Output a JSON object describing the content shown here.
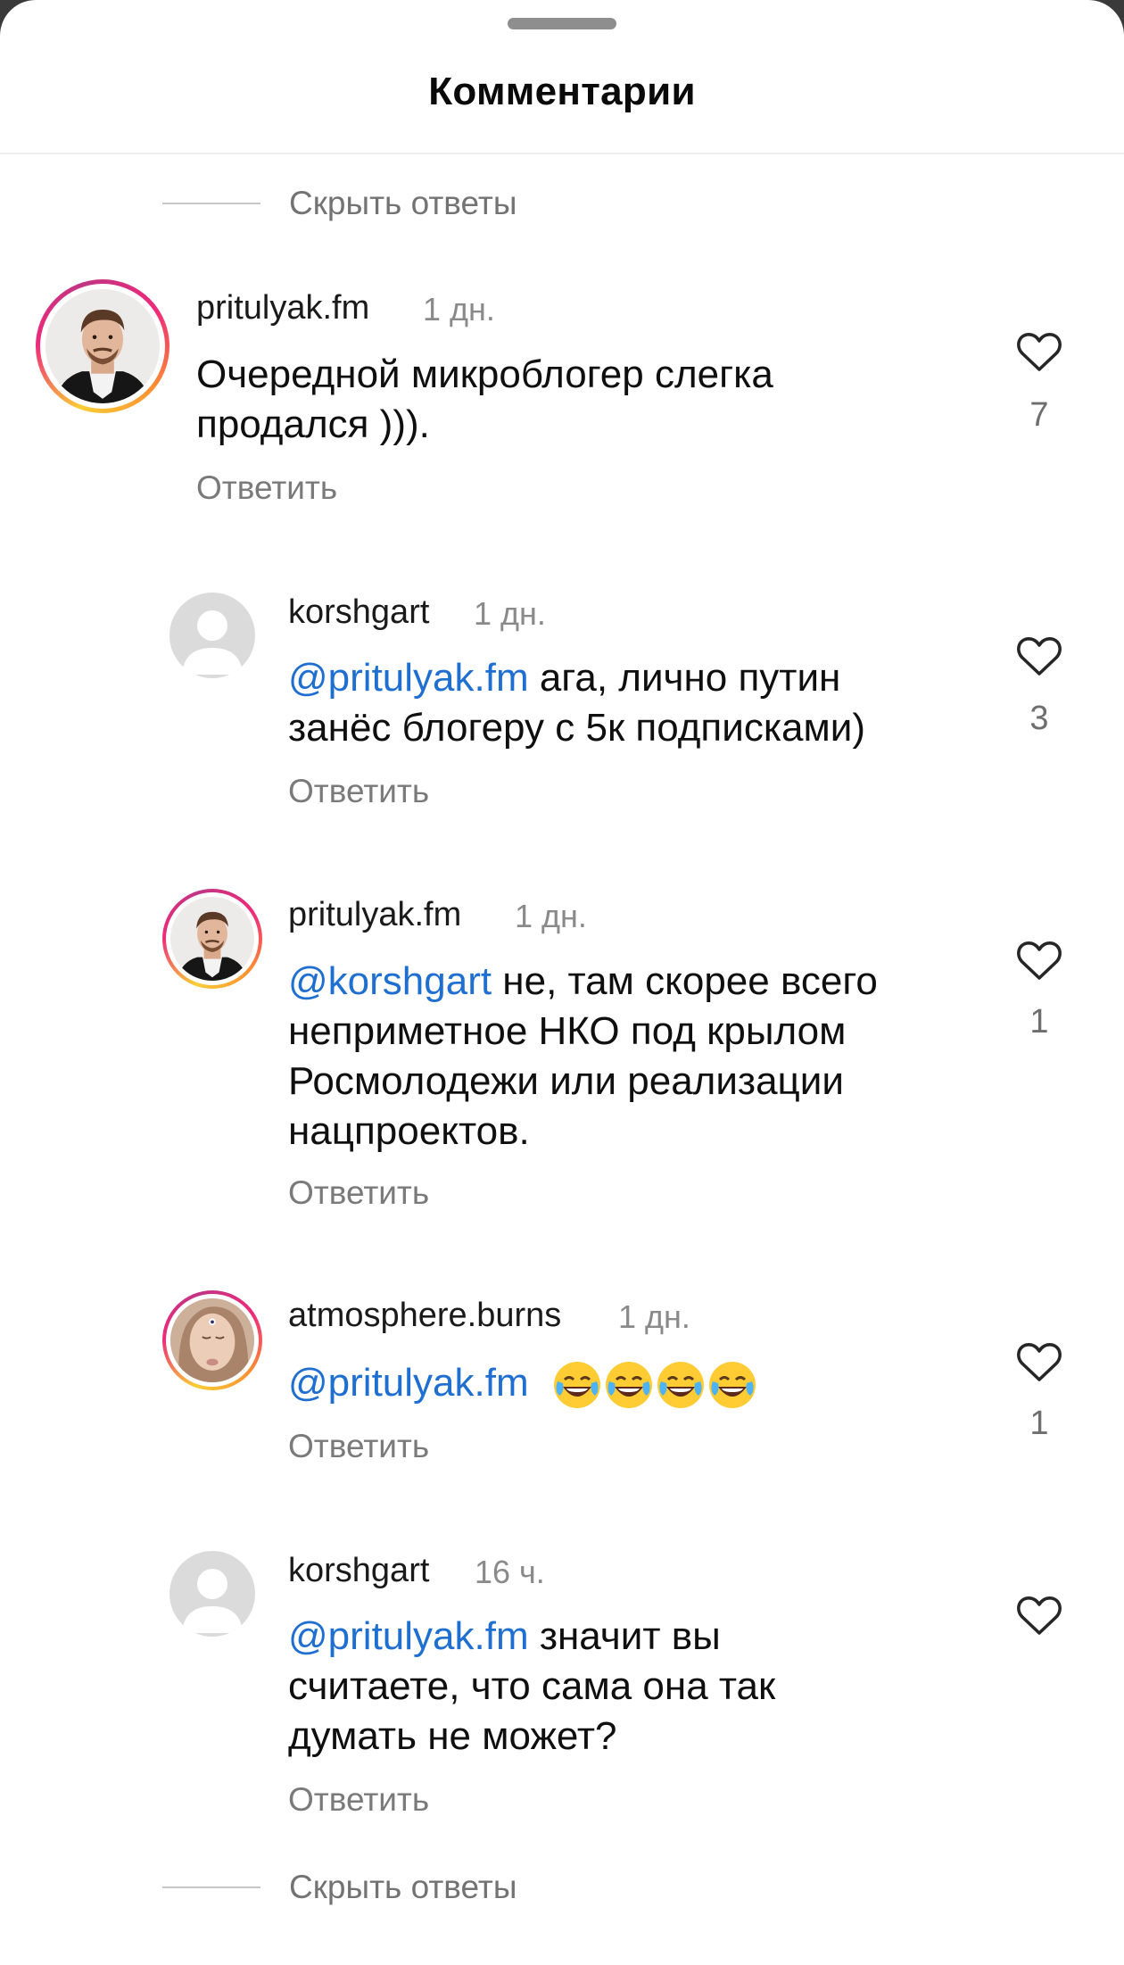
{
  "sheet": {
    "title": "Комментарии",
    "hide_replies_top": "Скрыть ответы",
    "hide_replies_bottom": "Скрыть ответы"
  },
  "comments": [
    {
      "username": "pritulyak.fm",
      "time": "1 дн.",
      "lines": [
        "Очередной микроблогер слегка",
        "продался )))."
      ],
      "reply_label": "Ответить",
      "likes": "7",
      "avatar": "photo-man-beard"
    },
    {
      "username": "korshgart",
      "time": "1 дн.",
      "mention": "@pritulyak.fm",
      "lines": [
        " ага, лично путин",
        "занёс блогеру с 5к подписками)"
      ],
      "reply_label": "Ответить",
      "likes": "3",
      "avatar": "default-avatar"
    },
    {
      "username": "pritulyak.fm",
      "time": "1 дн.",
      "mention": "@korshgart",
      "lines": [
        " не, там скорее всего",
        "неприметное НКО под крылом",
        "Росмолодежи или реализации",
        "нацпроектов."
      ],
      "reply_label": "Ответить",
      "likes": "1",
      "avatar": "photo-man-beard"
    },
    {
      "username": "atmosphere.burns",
      "time": "1 дн.",
      "mention": "@pritulyak.fm",
      "emoji": "crying-laughing-emoji",
      "reply_label": "Ответить",
      "likes": "1",
      "avatar": "photo-woman"
    },
    {
      "username": "korshgart",
      "time": "16 ч.",
      "mention": "@pritulyak.fm",
      "lines": [
        " значит вы",
        "считаете, что сама она так",
        "думать не может?"
      ],
      "reply_label": "Ответить",
      "avatar": "default-avatar"
    }
  ],
  "colors": {
    "mention": "#1f6fd1",
    "secondary_text": "#7a7a7a",
    "heart_outline": "#262626"
  }
}
